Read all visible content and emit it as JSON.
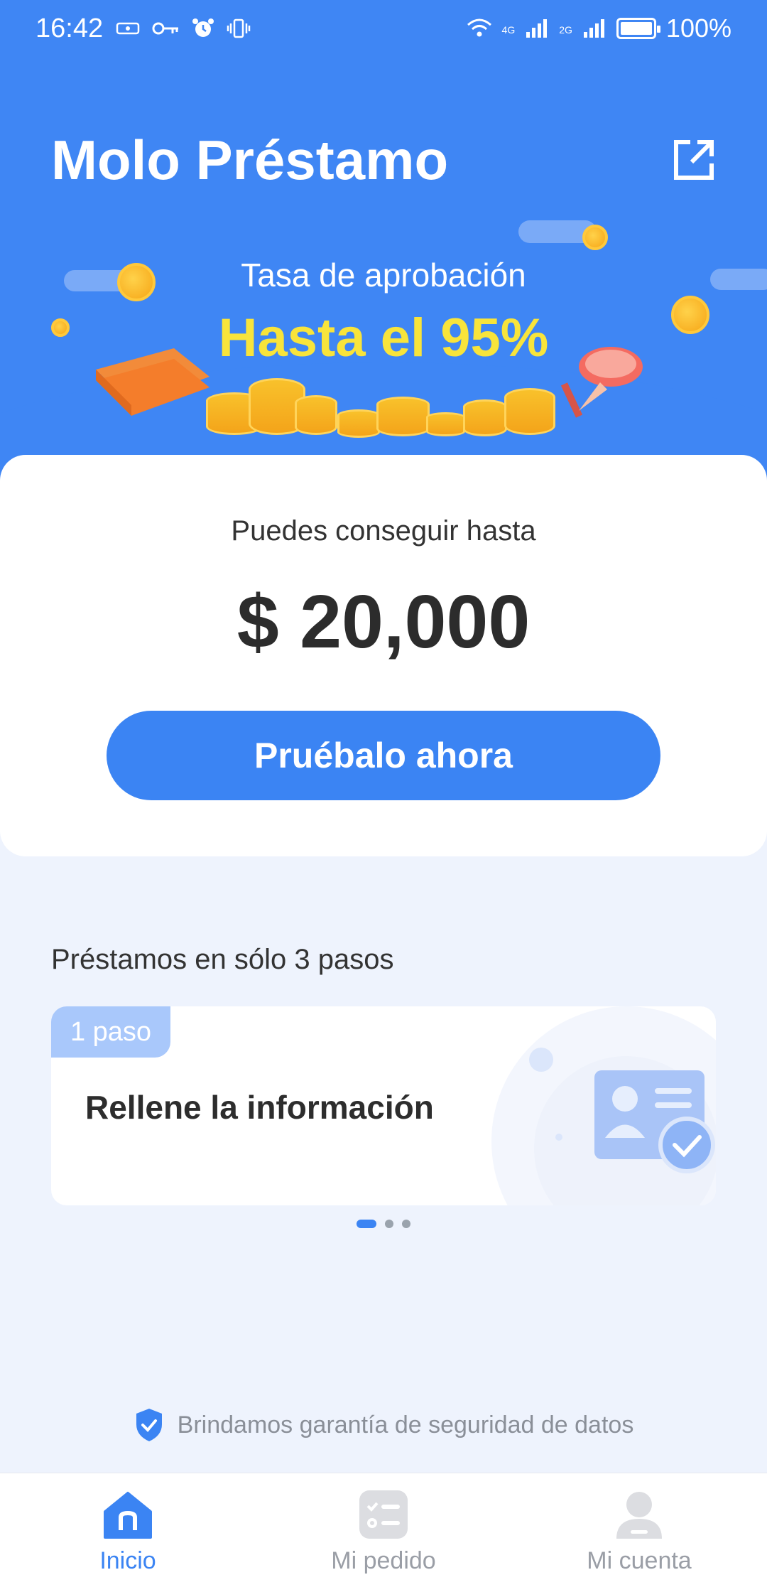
{
  "status_bar": {
    "time": "16:42",
    "network_1": "4G",
    "network_2": "2G",
    "battery": "100%"
  },
  "header": {
    "app_title": "Molo Préstamo",
    "approval_label": "Tasa de aprobación",
    "approval_value": "Hasta el 95%",
    "colors": {
      "primary": "#3f86f4",
      "highlight": "#f8e43b"
    }
  },
  "amount_card": {
    "label": "Puedes conseguir hasta",
    "amount": "$ 20,000",
    "cta_label": "Pruébalo ahora"
  },
  "steps": {
    "title": "Préstamos en sólo 3 pasos",
    "current": {
      "badge": "1 paso",
      "text": "Rellene la información"
    },
    "pager": {
      "count": 3,
      "active_index": 0
    }
  },
  "security": {
    "text": "Brindamos garantía de seguridad de datos"
  },
  "bottom_nav": {
    "items": [
      {
        "label": "Inicio",
        "icon": "home-icon",
        "active": true
      },
      {
        "label": "Mi pedido",
        "icon": "order-list-icon",
        "active": false
      },
      {
        "label": "Mi cuenta",
        "icon": "account-icon",
        "active": false
      }
    ]
  }
}
